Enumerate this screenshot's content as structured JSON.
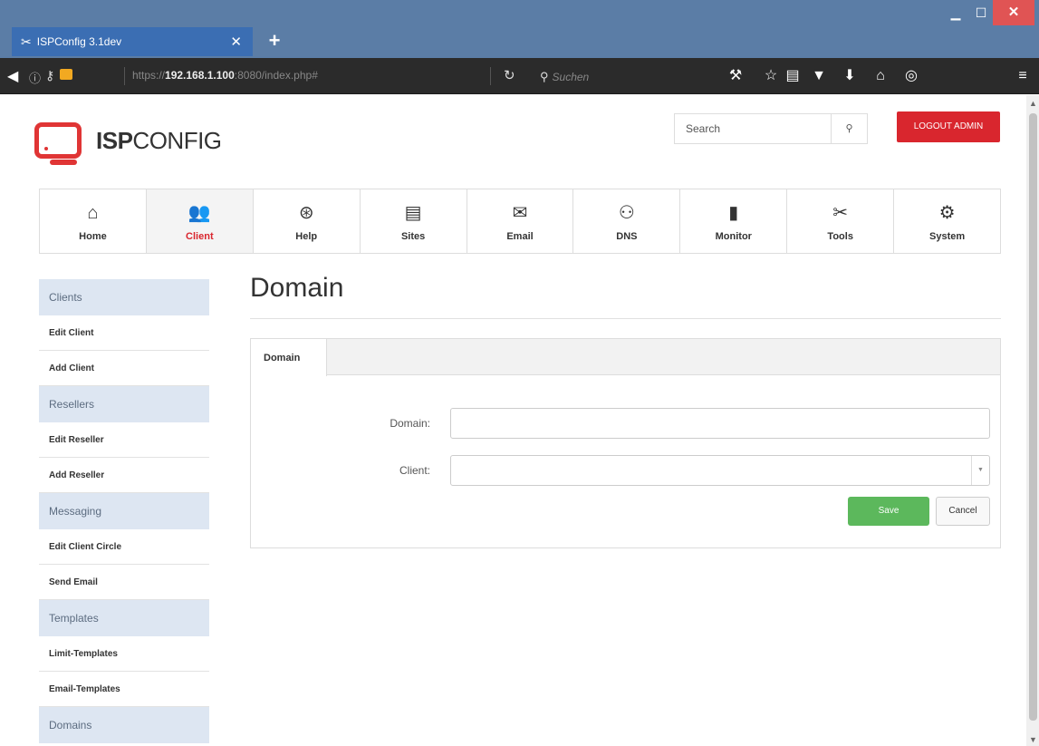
{
  "browser": {
    "tab_title": "ISPConfig 3.1dev",
    "tab_icon": "tools-icon",
    "new_tab_label": "+",
    "url_prefix": "https://",
    "url_host": "192.168.1.100",
    "url_rest": ":8080/index.php#",
    "search_placeholder": "Suchen"
  },
  "header": {
    "logo_bold": "ISP",
    "logo_light": "CONFIG",
    "search_placeholder": "Search",
    "logout_label": "LOGOUT ADMIN"
  },
  "nav": [
    {
      "label": "Home",
      "icon": "home-icon"
    },
    {
      "label": "Client",
      "icon": "users-icon",
      "active": true
    },
    {
      "label": "Help",
      "icon": "lifebuoy-icon"
    },
    {
      "label": "Sites",
      "icon": "sites-icon"
    },
    {
      "label": "Email",
      "icon": "envelope-icon"
    },
    {
      "label": "DNS",
      "icon": "network-icon"
    },
    {
      "label": "Monitor",
      "icon": "traffic-light-icon"
    },
    {
      "label": "Tools",
      "icon": "tools-icon"
    },
    {
      "label": "System",
      "icon": "gear-icon"
    }
  ],
  "sidebar": [
    {
      "header": "Clients",
      "links": [
        "Edit Client",
        "Add Client"
      ]
    },
    {
      "header": "Resellers",
      "links": [
        "Edit Reseller",
        "Add Reseller"
      ]
    },
    {
      "header": "Messaging",
      "links": [
        "Edit Client Circle",
        "Send Email"
      ]
    },
    {
      "header": "Templates",
      "links": [
        "Limit-Templates",
        "Email-Templates"
      ]
    },
    {
      "header": "Domains",
      "links": []
    }
  ],
  "main": {
    "title": "Domain",
    "tab_label": "Domain",
    "domain_label": "Domain:",
    "domain_value": "",
    "client_label": "Client:",
    "client_value": "",
    "save_label": "Save",
    "cancel_label": "Cancel"
  },
  "colors": {
    "brand_red": "#d9262e",
    "save_green": "#5cb85c",
    "sidebar_header": "#dde6f2"
  }
}
